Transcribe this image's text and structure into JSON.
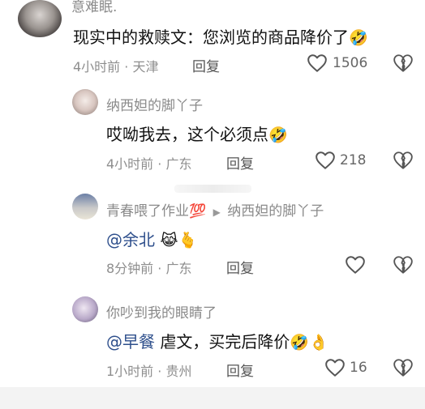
{
  "comments": [
    {
      "username": "意难眠.",
      "text": "现实中的救赎文：您浏览的商品降价了",
      "emoji": "🤣",
      "time": "4小时前",
      "location": "天津",
      "reply_label": "回复",
      "likes": "1506"
    },
    {
      "username": "纳西妲的脚丫子",
      "text": "哎呦我去，这个必须点",
      "emoji": "🤣",
      "time": "4小时前",
      "location": "广东",
      "reply_label": "回复",
      "likes": "218"
    },
    {
      "username": "青春喂了作业💯",
      "reply_to": "纳西妲的脚丫子",
      "mention": "@余北",
      "emoji": "😹🫰",
      "time": "8分钟前",
      "location": "广东",
      "reply_label": "回复",
      "likes": ""
    },
    {
      "username": "你吵到我的眼睛了",
      "mention": "@早餐",
      "text": " 虐文，买完后降价",
      "emoji": "🤣👌",
      "time": "1小时前",
      "location": "贵州",
      "reply_label": "回复",
      "likes": "16"
    }
  ],
  "separator": "·",
  "reply_arrow": "▶"
}
